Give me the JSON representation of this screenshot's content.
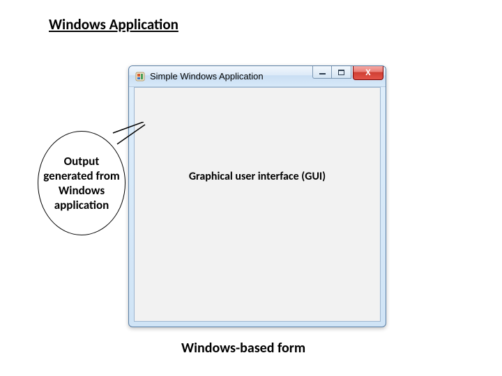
{
  "section_title": "Windows Application",
  "callout": {
    "text": "Output generated from Windows application"
  },
  "window": {
    "title": "Simple Windows Application",
    "client_label": "Graphical user interface (GUI)"
  },
  "bottom_caption": "Windows-based form"
}
